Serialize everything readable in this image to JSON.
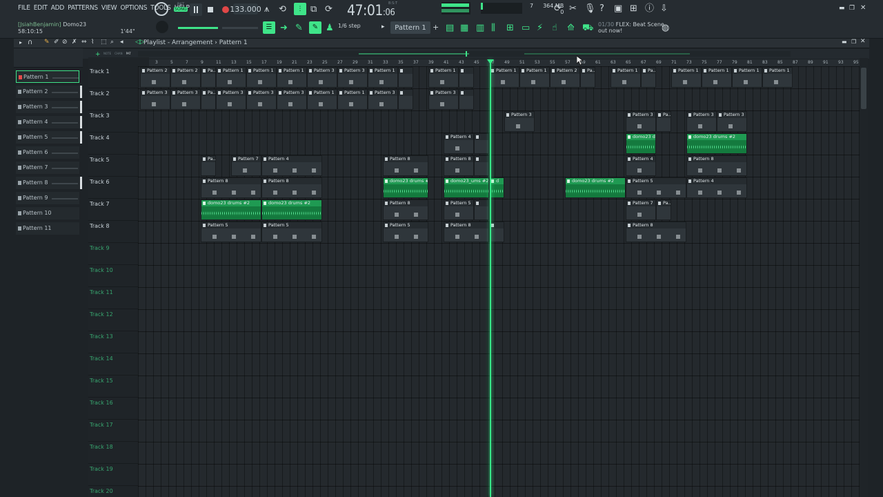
{
  "menu": [
    "FILE",
    "EDIT",
    "ADD",
    "PATTERNS",
    "VIEW",
    "OPTIONS",
    "TOOLS",
    "HELP"
  ],
  "project": {
    "user": "[JsiahBenjamin]",
    "name": "Domo23",
    "elapsed": "58:10:15",
    "length": "1'44\""
  },
  "transport": {
    "pat_label": "PAT",
    "song_label": "SONG",
    "bpm": "133.000",
    "time_main": "47:01",
    "time_sub": "06",
    "mst_label": "B:S:T"
  },
  "memory": {
    "cpu": "7",
    "ram": "364 MB",
    "poly": "0"
  },
  "step": "1/6 step",
  "pattern_selector": "Pattern 1",
  "hint": {
    "counter": "01/30",
    "text1": "FLEX: Beat Scene",
    "text2": "out now!"
  },
  "playlist": {
    "breadcrumb": "Playlist - Arrangement",
    "breadcrumb_sep": "›",
    "breadcrumb_pattern": "Pattern 1",
    "tabs_small": [
      "NOTE",
      "CHAN",
      "PAT"
    ]
  },
  "patterns": [
    "Pattern 1",
    "Pattern 2",
    "Pattern 3",
    "Pattern 4",
    "Pattern 5",
    "Pattern 6",
    "Pattern 7",
    "Pattern 8",
    "Pattern 9",
    "Pattern 10",
    "Pattern 11"
  ],
  "tracks": [
    "Track 1",
    "Track 2",
    "Track 3",
    "Track 4",
    "Track 5",
    "Track 6",
    "Track 7",
    "Track 8",
    "Track 9",
    "Track 10",
    "Track 11",
    "Track 12",
    "Track 13",
    "Track 14",
    "Track 15",
    "Track 16",
    "Track 17",
    "Track 18",
    "Track 19",
    "Track 20"
  ],
  "ruler": [
    "1",
    "3",
    "5",
    "7",
    "9",
    "11",
    "13",
    "15",
    "17",
    "19",
    "21",
    "23",
    "25",
    "27",
    "29",
    "31",
    "33",
    "35",
    "37",
    "39",
    "41",
    "43",
    "45",
    "47",
    "49",
    "51",
    "53",
    "55",
    "57",
    "59",
    "61",
    "63",
    "65",
    "67",
    "69",
    "71",
    "73",
    "75",
    "77",
    "79",
    "81",
    "83",
    "85",
    "87",
    "89",
    "91",
    "93",
    "95"
  ],
  "clips": [
    {
      "track": 0,
      "bar": 1,
      "len": 4,
      "label": "Pattern 2"
    },
    {
      "track": 0,
      "bar": 5,
      "len": 4,
      "label": "Pattern 2"
    },
    {
      "track": 0,
      "bar": 9,
      "len": 2,
      "label": "Pa..n 1"
    },
    {
      "track": 0,
      "bar": 11,
      "len": 4,
      "label": "Pattern 1"
    },
    {
      "track": 0,
      "bar": 15,
      "len": 4,
      "label": "Pattern 1"
    },
    {
      "track": 0,
      "bar": 19,
      "len": 4,
      "label": "Pattern 1"
    },
    {
      "track": 0,
      "bar": 23,
      "len": 4,
      "label": "Pattern 3"
    },
    {
      "track": 0,
      "bar": 27,
      "len": 4,
      "label": "Pattern 3"
    },
    {
      "track": 0,
      "bar": 31,
      "len": 4,
      "label": "Pattern 1"
    },
    {
      "track": 0,
      "bar": 35,
      "len": 2,
      "label": ""
    },
    {
      "track": 0,
      "bar": 39,
      "len": 4,
      "label": "Pattern 1"
    },
    {
      "track": 0,
      "bar": 43,
      "len": 2,
      "label": ""
    },
    {
      "track": 0,
      "bar": 47,
      "len": 4,
      "label": "Pattern 1"
    },
    {
      "track": 0,
      "bar": 51,
      "len": 4,
      "label": "Pattern 1"
    },
    {
      "track": 0,
      "bar": 55,
      "len": 4,
      "label": "Pattern 2"
    },
    {
      "track": 0,
      "bar": 59,
      "len": 2,
      "label": "Pa..n 2"
    },
    {
      "track": 0,
      "bar": 63,
      "len": 4,
      "label": "Pattern 1"
    },
    {
      "track": 0,
      "bar": 67,
      "len": 2,
      "label": "Pa..1"
    },
    {
      "track": 0,
      "bar": 71,
      "len": 4,
      "label": "Pattern 1"
    },
    {
      "track": 0,
      "bar": 75,
      "len": 4,
      "label": "Pattern 1"
    },
    {
      "track": 0,
      "bar": 79,
      "len": 4,
      "label": "Pattern 1"
    },
    {
      "track": 0,
      "bar": 83,
      "len": 4,
      "label": "Pattern 1"
    },
    {
      "track": 1,
      "bar": 1,
      "len": 4,
      "label": "Pattern 3"
    },
    {
      "track": 1,
      "bar": 5,
      "len": 4,
      "label": "Pattern 3"
    },
    {
      "track": 1,
      "bar": 9,
      "len": 2,
      "label": "Pa..n 3"
    },
    {
      "track": 1,
      "bar": 11,
      "len": 4,
      "label": "Pattern 3"
    },
    {
      "track": 1,
      "bar": 15,
      "len": 4,
      "label": "Pattern 3"
    },
    {
      "track": 1,
      "bar": 19,
      "len": 4,
      "label": "Pattern 3"
    },
    {
      "track": 1,
      "bar": 23,
      "len": 4,
      "label": "Pattern 1"
    },
    {
      "track": 1,
      "bar": 27,
      "len": 4,
      "label": "Pattern 1"
    },
    {
      "track": 1,
      "bar": 31,
      "len": 4,
      "label": "Pattern 3"
    },
    {
      "track": 1,
      "bar": 35,
      "len": 2,
      "label": ""
    },
    {
      "track": 1,
      "bar": 39,
      "len": 4,
      "label": "Pattern 3"
    },
    {
      "track": 1,
      "bar": 43,
      "len": 2,
      "label": ""
    },
    {
      "track": 2,
      "bar": 49,
      "len": 4,
      "label": "Pattern 3"
    },
    {
      "track": 2,
      "bar": 65,
      "len": 4,
      "label": "Pattern 3"
    },
    {
      "track": 2,
      "bar": 69,
      "len": 2,
      "label": "Pa..3"
    },
    {
      "track": 2,
      "bar": 73,
      "len": 4,
      "label": "Pattern 3"
    },
    {
      "track": 2,
      "bar": 77,
      "len": 4,
      "label": "Pattern 3"
    },
    {
      "track": 3,
      "bar": 41,
      "len": 4,
      "label": "Pattern 4"
    },
    {
      "track": 3,
      "bar": 45,
      "len": 2,
      "label": ""
    },
    {
      "track": 3,
      "bar": 65,
      "len": 4,
      "label": "domo23 drums #2",
      "audio": true
    },
    {
      "track": 3,
      "bar": 73,
      "len": 8,
      "label": "domo23 drums #2",
      "audio": true
    },
    {
      "track": 4,
      "bar": 9,
      "len": 2,
      "label": "Pa..n 7"
    },
    {
      "track": 4,
      "bar": 13,
      "len": 4,
      "label": "Pattern 7"
    },
    {
      "track": 4,
      "bar": 17,
      "len": 8,
      "label": "Pattern 4"
    },
    {
      "track": 4,
      "bar": 33,
      "len": 6,
      "label": "Pattern 8"
    },
    {
      "track": 4,
      "bar": 41,
      "len": 4,
      "label": "Pattern 8"
    },
    {
      "track": 4,
      "bar": 45,
      "len": 2,
      "label": ""
    },
    {
      "track": 4,
      "bar": 65,
      "len": 4,
      "label": "Pattern 4"
    },
    {
      "track": 4,
      "bar": 73,
      "len": 8,
      "label": "Pattern 8"
    },
    {
      "track": 5,
      "bar": 9,
      "len": 8,
      "label": "Pattern 8"
    },
    {
      "track": 5,
      "bar": 17,
      "len": 8,
      "label": "Pattern 8"
    },
    {
      "track": 5,
      "bar": 33,
      "len": 6,
      "label": "domo23 drums #2",
      "audio": true
    },
    {
      "track": 5,
      "bar": 41,
      "len": 6,
      "label": "domo23_ums #2",
      "audio": true
    },
    {
      "track": 5,
      "bar": 47,
      "len": 2,
      "label": "d",
      "audio": true
    },
    {
      "track": 5,
      "bar": 57,
      "len": 8,
      "label": "domo23 drums #2",
      "audio": true
    },
    {
      "track": 5,
      "bar": 65,
      "len": 8,
      "label": "Pattern 5"
    },
    {
      "track": 5,
      "bar": 73,
      "len": 8,
      "label": "Pattern 4"
    },
    {
      "track": 6,
      "bar": 9,
      "len": 8,
      "label": "domo23 drums #2",
      "audio": true
    },
    {
      "track": 6,
      "bar": 17,
      "len": 8,
      "label": "domo23 drums #2",
      "audio": true
    },
    {
      "track": 6,
      "bar": 33,
      "len": 6,
      "label": "Pattern 8"
    },
    {
      "track": 6,
      "bar": 41,
      "len": 4,
      "label": "Pattern 5"
    },
    {
      "track": 6,
      "bar": 45,
      "len": 2,
      "label": ""
    },
    {
      "track": 6,
      "bar": 65,
      "len": 4,
      "label": "Pattern 7"
    },
    {
      "track": 6,
      "bar": 69,
      "len": 2,
      "label": "Pa..7"
    },
    {
      "track": 7,
      "bar": 9,
      "len": 8,
      "label": "Pattern 5"
    },
    {
      "track": 7,
      "bar": 17,
      "len": 8,
      "label": "Pattern 5"
    },
    {
      "track": 7,
      "bar": 33,
      "len": 6,
      "label": "Pattern 5"
    },
    {
      "track": 7,
      "bar": 41,
      "len": 6,
      "label": "Pattern 8"
    },
    {
      "track": 7,
      "bar": 47,
      "len": 2,
      "label": ""
    },
    {
      "track": 7,
      "bar": 65,
      "len": 8,
      "label": "Pattern 8"
    }
  ],
  "playhead_bar": 47.1
}
